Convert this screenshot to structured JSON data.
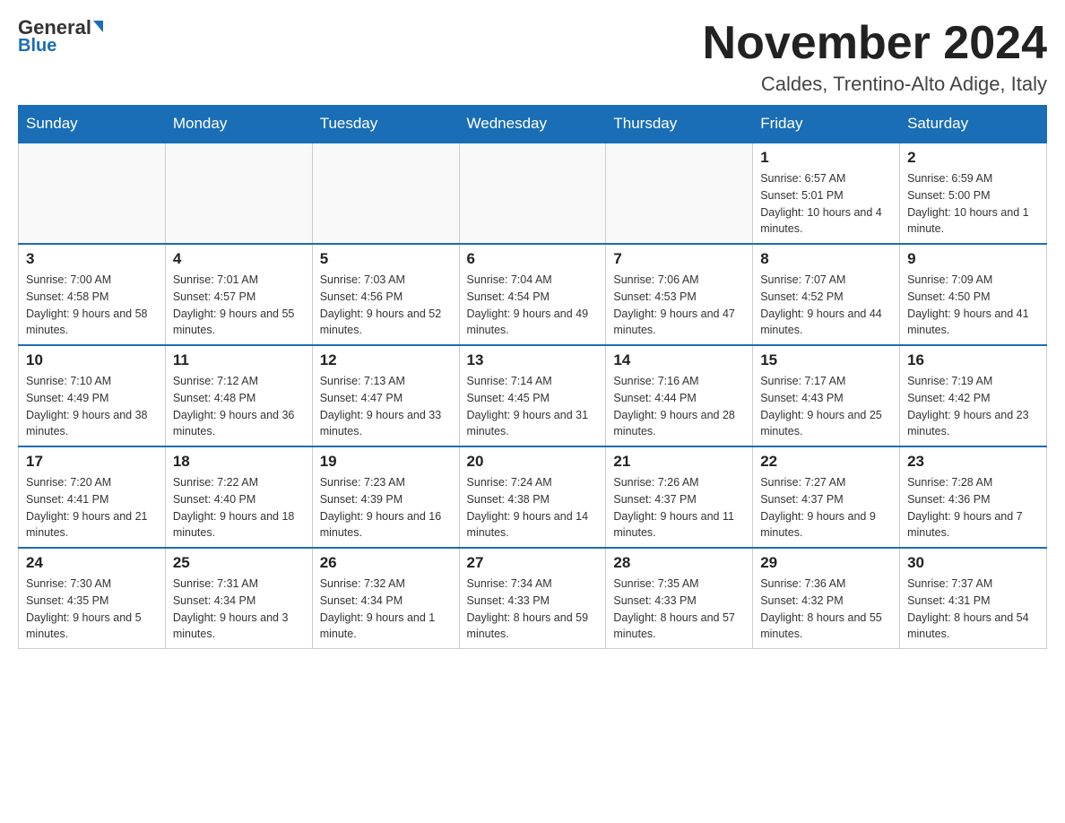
{
  "logo": {
    "general": "General",
    "blue": "Blue"
  },
  "header": {
    "title": "November 2024",
    "location": "Caldes, Trentino-Alto Adige, Italy"
  },
  "weekdays": [
    "Sunday",
    "Monday",
    "Tuesday",
    "Wednesday",
    "Thursday",
    "Friday",
    "Saturday"
  ],
  "weeks": [
    {
      "days": [
        {
          "number": "",
          "info": ""
        },
        {
          "number": "",
          "info": ""
        },
        {
          "number": "",
          "info": ""
        },
        {
          "number": "",
          "info": ""
        },
        {
          "number": "",
          "info": ""
        },
        {
          "number": "1",
          "info": "Sunrise: 6:57 AM\nSunset: 5:01 PM\nDaylight: 10 hours and 4 minutes."
        },
        {
          "number": "2",
          "info": "Sunrise: 6:59 AM\nSunset: 5:00 PM\nDaylight: 10 hours and 1 minute."
        }
      ]
    },
    {
      "days": [
        {
          "number": "3",
          "info": "Sunrise: 7:00 AM\nSunset: 4:58 PM\nDaylight: 9 hours and 58 minutes."
        },
        {
          "number": "4",
          "info": "Sunrise: 7:01 AM\nSunset: 4:57 PM\nDaylight: 9 hours and 55 minutes."
        },
        {
          "number": "5",
          "info": "Sunrise: 7:03 AM\nSunset: 4:56 PM\nDaylight: 9 hours and 52 minutes."
        },
        {
          "number": "6",
          "info": "Sunrise: 7:04 AM\nSunset: 4:54 PM\nDaylight: 9 hours and 49 minutes."
        },
        {
          "number": "7",
          "info": "Sunrise: 7:06 AM\nSunset: 4:53 PM\nDaylight: 9 hours and 47 minutes."
        },
        {
          "number": "8",
          "info": "Sunrise: 7:07 AM\nSunset: 4:52 PM\nDaylight: 9 hours and 44 minutes."
        },
        {
          "number": "9",
          "info": "Sunrise: 7:09 AM\nSunset: 4:50 PM\nDaylight: 9 hours and 41 minutes."
        }
      ]
    },
    {
      "days": [
        {
          "number": "10",
          "info": "Sunrise: 7:10 AM\nSunset: 4:49 PM\nDaylight: 9 hours and 38 minutes."
        },
        {
          "number": "11",
          "info": "Sunrise: 7:12 AM\nSunset: 4:48 PM\nDaylight: 9 hours and 36 minutes."
        },
        {
          "number": "12",
          "info": "Sunrise: 7:13 AM\nSunset: 4:47 PM\nDaylight: 9 hours and 33 minutes."
        },
        {
          "number": "13",
          "info": "Sunrise: 7:14 AM\nSunset: 4:45 PM\nDaylight: 9 hours and 31 minutes."
        },
        {
          "number": "14",
          "info": "Sunrise: 7:16 AM\nSunset: 4:44 PM\nDaylight: 9 hours and 28 minutes."
        },
        {
          "number": "15",
          "info": "Sunrise: 7:17 AM\nSunset: 4:43 PM\nDaylight: 9 hours and 25 minutes."
        },
        {
          "number": "16",
          "info": "Sunrise: 7:19 AM\nSunset: 4:42 PM\nDaylight: 9 hours and 23 minutes."
        }
      ]
    },
    {
      "days": [
        {
          "number": "17",
          "info": "Sunrise: 7:20 AM\nSunset: 4:41 PM\nDaylight: 9 hours and 21 minutes."
        },
        {
          "number": "18",
          "info": "Sunrise: 7:22 AM\nSunset: 4:40 PM\nDaylight: 9 hours and 18 minutes."
        },
        {
          "number": "19",
          "info": "Sunrise: 7:23 AM\nSunset: 4:39 PM\nDaylight: 9 hours and 16 minutes."
        },
        {
          "number": "20",
          "info": "Sunrise: 7:24 AM\nSunset: 4:38 PM\nDaylight: 9 hours and 14 minutes."
        },
        {
          "number": "21",
          "info": "Sunrise: 7:26 AM\nSunset: 4:37 PM\nDaylight: 9 hours and 11 minutes."
        },
        {
          "number": "22",
          "info": "Sunrise: 7:27 AM\nSunset: 4:37 PM\nDaylight: 9 hours and 9 minutes."
        },
        {
          "number": "23",
          "info": "Sunrise: 7:28 AM\nSunset: 4:36 PM\nDaylight: 9 hours and 7 minutes."
        }
      ]
    },
    {
      "days": [
        {
          "number": "24",
          "info": "Sunrise: 7:30 AM\nSunset: 4:35 PM\nDaylight: 9 hours and 5 minutes."
        },
        {
          "number": "25",
          "info": "Sunrise: 7:31 AM\nSunset: 4:34 PM\nDaylight: 9 hours and 3 minutes."
        },
        {
          "number": "26",
          "info": "Sunrise: 7:32 AM\nSunset: 4:34 PM\nDaylight: 9 hours and 1 minute."
        },
        {
          "number": "27",
          "info": "Sunrise: 7:34 AM\nSunset: 4:33 PM\nDaylight: 8 hours and 59 minutes."
        },
        {
          "number": "28",
          "info": "Sunrise: 7:35 AM\nSunset: 4:33 PM\nDaylight: 8 hours and 57 minutes."
        },
        {
          "number": "29",
          "info": "Sunrise: 7:36 AM\nSunset: 4:32 PM\nDaylight: 8 hours and 55 minutes."
        },
        {
          "number": "30",
          "info": "Sunrise: 7:37 AM\nSunset: 4:31 PM\nDaylight: 8 hours and 54 minutes."
        }
      ]
    }
  ]
}
